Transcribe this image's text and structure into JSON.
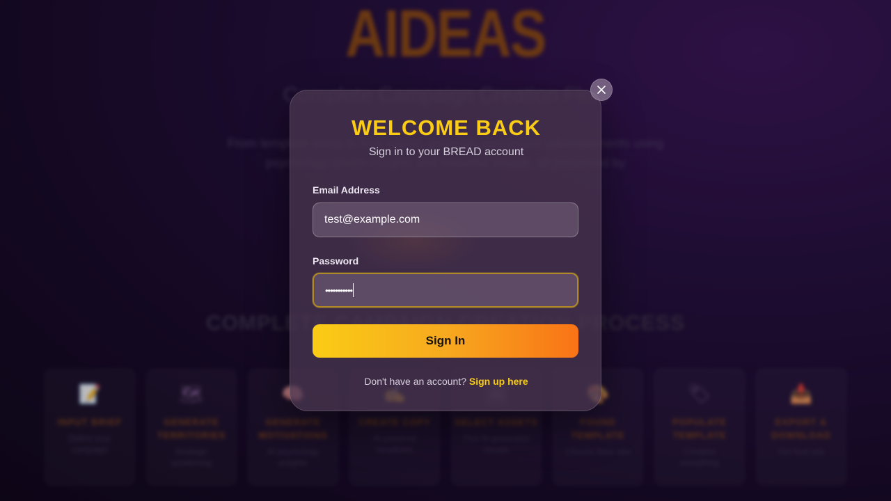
{
  "background": {
    "logo": "AIDEAS",
    "subtitle": "Complete Campaign Creation Flow",
    "description": "From template setup to final export, generate persuasive advertisements using psychology-driven insights and beautiful visuals, all presented by",
    "section_title": "COMPLETE CAMPAIGN CREATION PROCESS",
    "steps": [
      {
        "icon": "clipboard-icon",
        "glyph": "📝",
        "title": "INPUT BRIEF",
        "desc": "Define your campaign"
      },
      {
        "icon": "map-icon",
        "glyph": "🗺",
        "title": "GENERATE TERRITORIES",
        "desc": "Strategic positioning"
      },
      {
        "icon": "brain-icon",
        "glyph": "🧠",
        "title": "GENERATE MOTIVATIONS",
        "desc": "AI psychology insights"
      },
      {
        "icon": "pen-icon",
        "glyph": "✍",
        "title": "CREATE COPY",
        "desc": "AI-powered headlines"
      },
      {
        "icon": "image-icon",
        "glyph": "🖼",
        "title": "SELECT ASSETS",
        "desc": "Pick AI-generated visuals"
      },
      {
        "icon": "palette-icon",
        "glyph": "🎨",
        "title": "FOUND TEMPLATE",
        "desc": "Choose base ads"
      },
      {
        "icon": "tag-icon",
        "glyph": "🏷",
        "title": "POPULATE TEMPLATE",
        "desc": "Combine everything"
      },
      {
        "icon": "download-icon",
        "glyph": "📥",
        "title": "EXPORT & DOWNLOAD",
        "desc": "Get final ads"
      }
    ]
  },
  "modal": {
    "title": "WELCOME BACK",
    "subtitle": "Sign in to your BREAD account",
    "email": {
      "label": "Email Address",
      "value": "test@example.com"
    },
    "password": {
      "label": "Password",
      "masked_value": "•••••••••••"
    },
    "submit_label": "Sign In",
    "footer_text": "Don't have an account?",
    "footer_link": "Sign up here",
    "close_icon": "close-icon"
  },
  "colors": {
    "accent": "#facc15",
    "gradient_end": "#f97316",
    "background": "#1a0c2c"
  }
}
